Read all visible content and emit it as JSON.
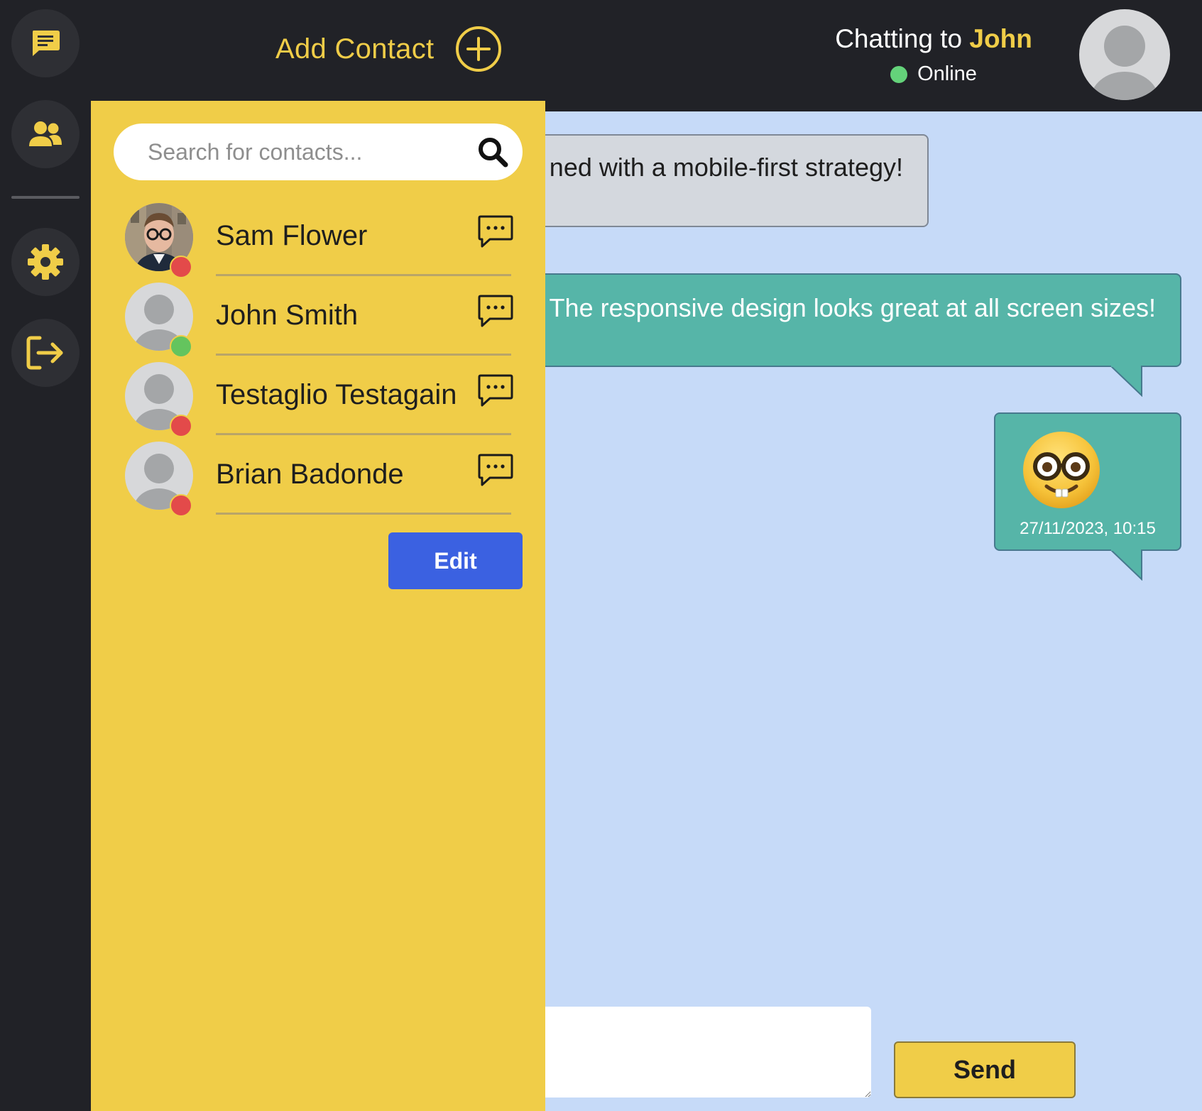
{
  "header": {
    "add_contact_label": "Add Contact",
    "chatting_prefix": "Chatting to",
    "chatting_name": "John",
    "status": "Online"
  },
  "rail": {
    "items": [
      {
        "icon": "chat-icon"
      },
      {
        "icon": "contacts-icon"
      },
      {
        "icon": "gear-icon"
      },
      {
        "icon": "logout-icon"
      }
    ]
  },
  "search": {
    "placeholder": "Search for contacts...",
    "value": ""
  },
  "contacts": [
    {
      "name": "Sam Flower",
      "status": "offline",
      "has_photo": true
    },
    {
      "name": "John Smith",
      "status": "online",
      "has_photo": false
    },
    {
      "name": "Testaglio Testagain",
      "status": "offline",
      "has_photo": false
    },
    {
      "name": "Brian Badonde",
      "status": "offline",
      "has_photo": false
    }
  ],
  "edit_label": "Edit",
  "messages": [
    {
      "text": "ned with a mobile-first strategy!",
      "sender": "contact"
    },
    {
      "text": "' The responsive design looks great at all screen sizes!",
      "sender": "self"
    },
    {
      "emoji": "nerd-face",
      "time": "27/11/2023, 10:15",
      "sender": "self"
    }
  ],
  "composer": {
    "value": "",
    "send_label": "Send"
  },
  "colors": {
    "accent": "#f0cd48",
    "dark": "#212227",
    "chat_bg": "#c6daf8",
    "self_bubble": "#56b5a8",
    "contact_bubble": "#d4d8de",
    "online": "#64d27a",
    "offline": "#e34a4a",
    "button_blue": "#3b61e1"
  }
}
